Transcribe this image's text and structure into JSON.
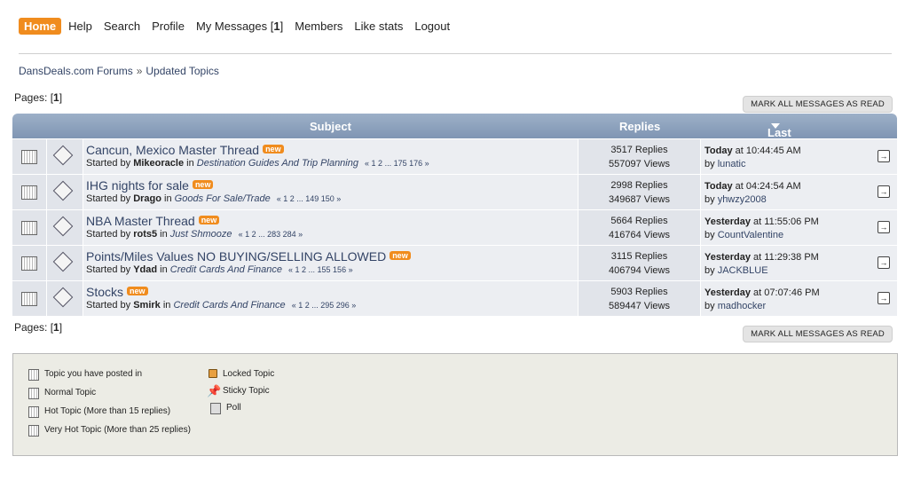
{
  "nav": {
    "home": "Home",
    "items": [
      "Help",
      "Search",
      "Profile"
    ],
    "messages_label": "My Messages",
    "messages_count": "1",
    "items2": [
      "Members",
      "Like stats",
      "Logout"
    ]
  },
  "breadcrumb": {
    "root": "DansDeals.com Forums",
    "sep": "»",
    "current": "Updated Topics"
  },
  "pages": {
    "label": "Pages:",
    "current": "1"
  },
  "mark_all": "MARK ALL MESSAGES AS READ",
  "table": {
    "headers": {
      "subject": "Subject",
      "replies": "Replies",
      "last_post": "Last post"
    },
    "rows": [
      {
        "title": "Cancun, Mexico Master Thread",
        "badge": "new",
        "started_label": "Started by",
        "author": "Mikeoracle",
        "in_label": "in",
        "board": "Destination Guides And Trip Planning",
        "page_links": "« 1 2 ... 175 176 »",
        "replies": "3517 Replies",
        "views": "557097 Views",
        "day": "Today",
        "time": "at 10:44:45 AM",
        "by_label": "by",
        "last_user": "lunatic"
      },
      {
        "title": "IHG nights for sale",
        "badge": "new",
        "started_label": "Started by",
        "author": "Drago",
        "in_label": "in",
        "board": "Goods For Sale/Trade",
        "page_links": "« 1 2 ... 149 150 »",
        "replies": "2998 Replies",
        "views": "349687 Views",
        "day": "Today",
        "time": "at 04:24:54 AM",
        "by_label": "by",
        "last_user": "yhwzy2008"
      },
      {
        "title": "NBA Master Thread",
        "badge": "new",
        "started_label": "Started by",
        "author": "rots5",
        "in_label": "in",
        "board": "Just Shmooze",
        "page_links": "« 1 2 ... 283 284 »",
        "replies": "5664 Replies",
        "views": "416764 Views",
        "day": "Yesterday",
        "time": "at 11:55:06 PM",
        "by_label": "by",
        "last_user": "CountValentine"
      },
      {
        "title": "Points/Miles Values NO BUYING/SELLING ALLOWED",
        "badge": "new",
        "started_label": "Started by",
        "author": "Ydad",
        "in_label": "in",
        "board": "Credit Cards And Finance",
        "page_links": "« 1 2 ... 155 156 »",
        "replies": "3115 Replies",
        "views": "406794 Views",
        "day": "Yesterday",
        "time": "at 11:29:38 PM",
        "by_label": "by",
        "last_user": "JACKBLUE"
      },
      {
        "title": "Stocks",
        "badge": "new",
        "started_label": "Started by",
        "author": "Smirk",
        "in_label": "in",
        "board": "Credit Cards And Finance",
        "page_links": "« 1 2 ... 295 296 »",
        "replies": "5903 Replies",
        "views": "589447 Views",
        "day": "Yesterday",
        "time": "at 07:07:46 PM",
        "by_label": "by",
        "last_user": "madhocker"
      }
    ]
  },
  "legend": {
    "posted": "Topic you have posted in",
    "normal": "Normal Topic",
    "hot": "Hot Topic (More than 15 replies)",
    "very_hot": "Very Hot Topic (More than 25 replies)",
    "locked": "Locked Topic",
    "sticky": "Sticky Topic",
    "poll": "Poll"
  },
  "colors": {
    "accent": "#f08c1e",
    "header": "#8ea3bf",
    "link": "#334466"
  }
}
